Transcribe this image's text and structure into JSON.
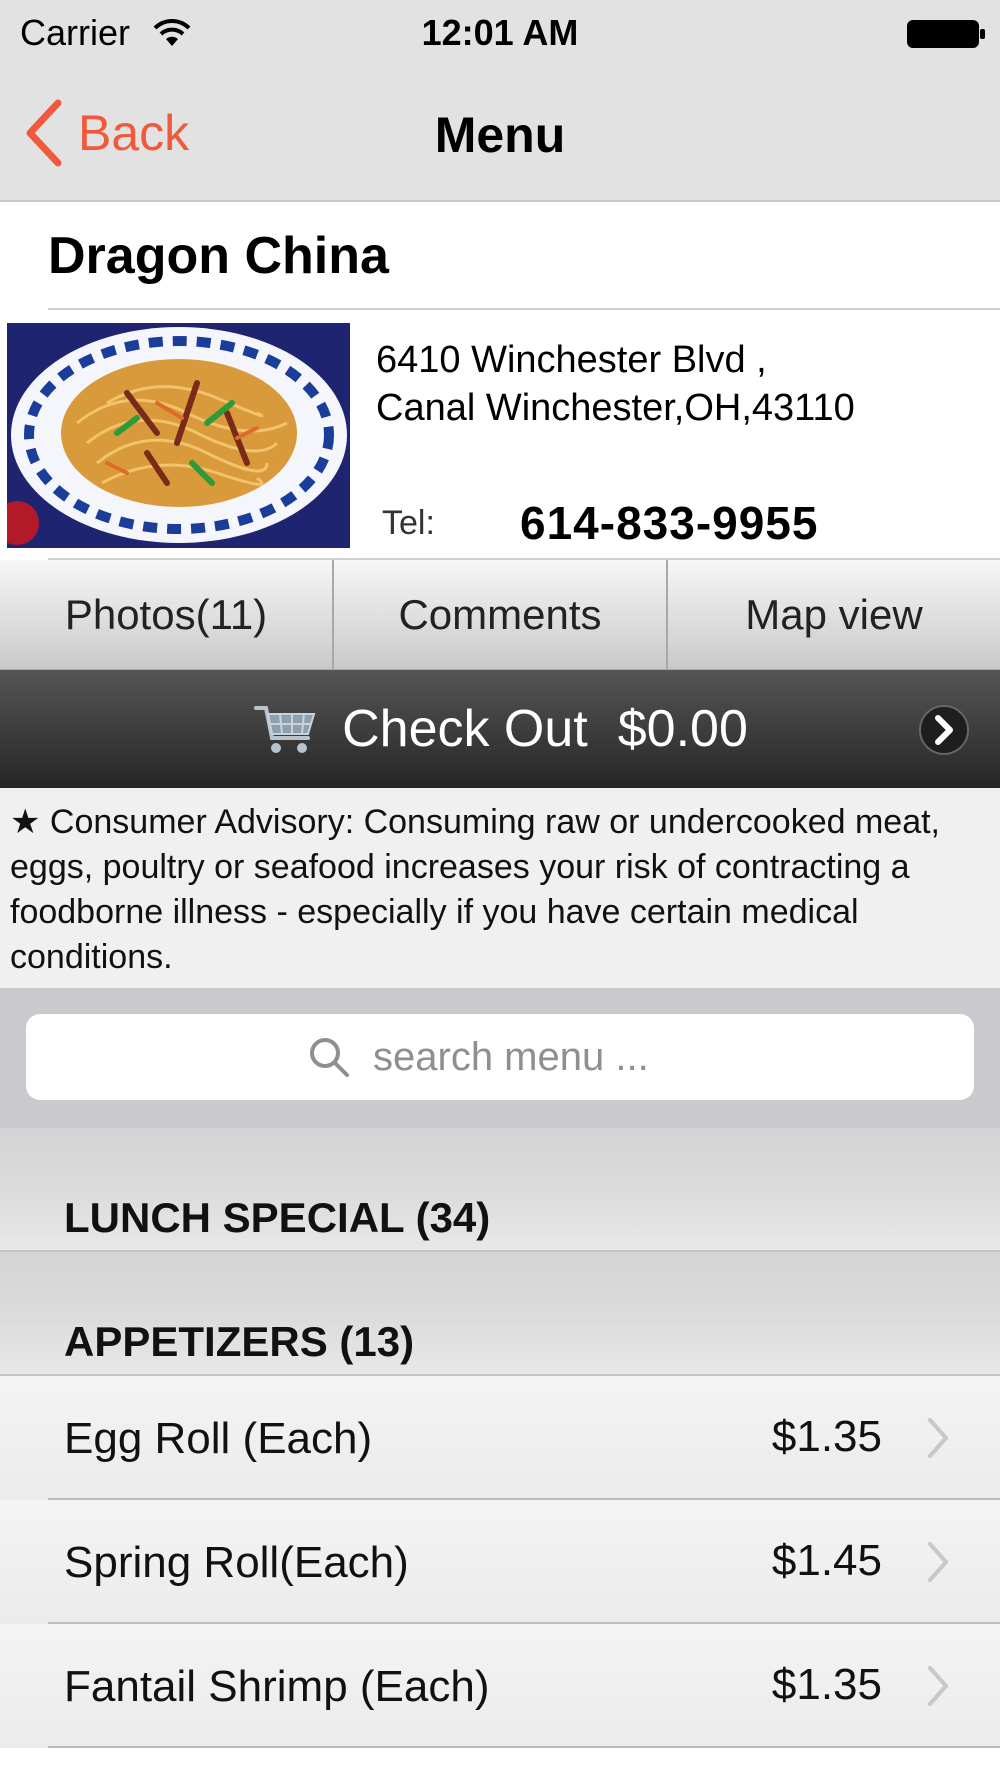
{
  "status_bar": {
    "carrier": "Carrier",
    "time": "12:01 AM"
  },
  "nav": {
    "back_label": "Back",
    "title": "Menu",
    "accent_color": "#ef5a3c"
  },
  "restaurant": {
    "name": "Dragon China",
    "address_line1": "6410 Winchester Blvd ,",
    "address_line2": "Canal Winchester,OH,43110",
    "tel_label": "Tel:",
    "tel_value": "614-833-9955"
  },
  "segments": [
    {
      "label": "Photos(11)"
    },
    {
      "label": "Comments"
    },
    {
      "label": "Map view"
    }
  ],
  "checkout": {
    "label": "Check Out",
    "total": "$0.00"
  },
  "advisory": {
    "text": "★ Consumer Advisory: Consuming raw or undercooked meat, eggs, poultry or seafood increases your risk of contracting a foodborne illness - especially if you have certain medical conditions."
  },
  "search": {
    "placeholder": "search menu ..."
  },
  "sections": [
    {
      "title": "LUNCH SPECIAL (34)"
    },
    {
      "title": "APPETIZERS (13)"
    }
  ],
  "menu_items": [
    {
      "name": "Egg Roll (Each)",
      "price": "$1.35"
    },
    {
      "name": "Spring Roll(Each)",
      "price": "$1.45"
    },
    {
      "name": "Fantail Shrimp (Each)",
      "price": "$1.35"
    }
  ]
}
